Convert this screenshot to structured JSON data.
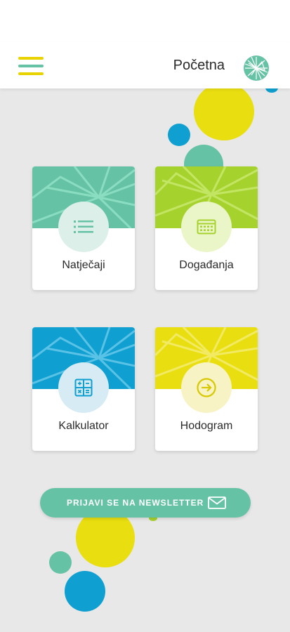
{
  "header": {
    "title": "Početna",
    "menu_icon": "hamburger-menu-icon",
    "logo_icon": "network-globe-logo"
  },
  "colors": {
    "teal": "#66c2a5",
    "lime": "#a6d22e",
    "blue": "#0f9fd0",
    "yellow": "#e9de10",
    "background": "#e8e8e8"
  },
  "cards": [
    {
      "label": "Natječaji",
      "icon": "list-icon",
      "color": "#66c2a5"
    },
    {
      "label": "Događanja",
      "icon": "calendar-icon",
      "color": "#a6d22e"
    },
    {
      "label": "Kalkulator",
      "icon": "calculator-icon",
      "color": "#0f9fd0"
    },
    {
      "label": "Hodogram",
      "icon": "arrow-right-circle-icon",
      "color": "#e9de10"
    }
  ],
  "newsletter": {
    "label": "PRIJAVI SE NA NEWSLETTER",
    "icon": "mail-icon"
  }
}
